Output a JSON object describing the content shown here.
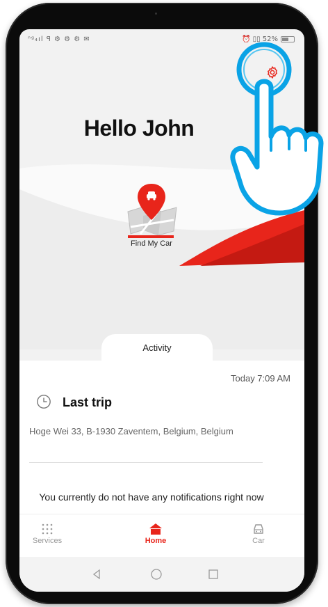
{
  "status_bar": {
    "left_icons": "ⁿᵍ₄ıl ꟼ ⚙ ⚙ ⚙ ✉",
    "right_text": "⏰ ▯▯ 52%"
  },
  "header": {
    "greeting": "Hello John",
    "settings_icon": "gear-icon"
  },
  "hero": {
    "find_car_label": "Find My Car",
    "accent_color": "#e8251b"
  },
  "activity": {
    "tab_label": "Activity",
    "timestamp": "Today 7:09 AM",
    "trip_title": "Last trip",
    "address": "Hoge Wei 33, B-1930 Zaventem, Belgium, Belgium",
    "notification_text": "You currently do not have any notifications right now"
  },
  "bottom_nav": {
    "items": [
      {
        "label": "Services",
        "icon": "grid-icon",
        "active": false
      },
      {
        "label": "Home",
        "icon": "home-icon",
        "active": true
      },
      {
        "label": "Car",
        "icon": "car-icon",
        "active": false
      }
    ]
  }
}
